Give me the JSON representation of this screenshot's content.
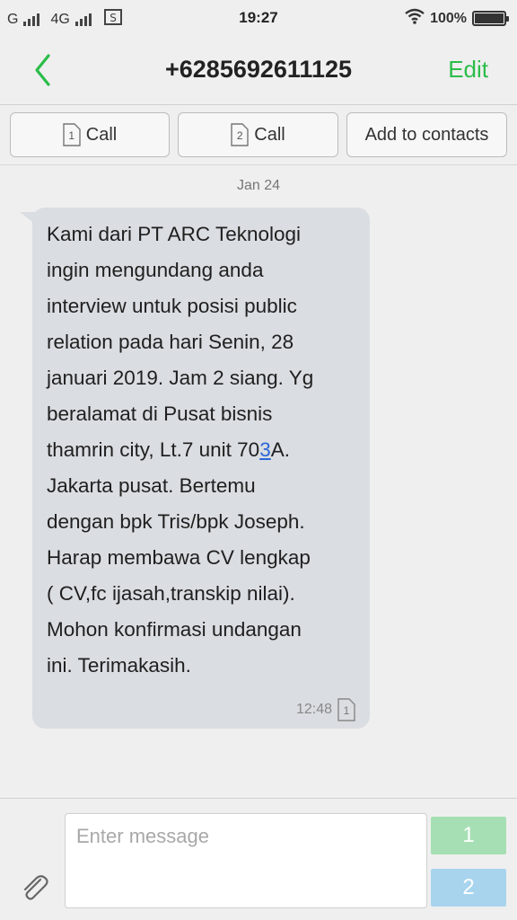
{
  "status_bar": {
    "carrier_1": "G",
    "carrier_2": "4G",
    "time": "19:27",
    "battery": "100%",
    "battery_level": 1.0,
    "icons": [
      "signal-icon",
      "sim-status-icon",
      "wifi-icon",
      "battery-icon"
    ]
  },
  "header": {
    "title": "+6285692611125",
    "edit_label": "Edit",
    "back_icon": "chevron-left-icon",
    "accent_color": "#2bbd4a"
  },
  "actions": {
    "call_sim1_label": "Call",
    "call_sim1_num": "1",
    "call_sim2_label": "Call",
    "call_sim2_num": "2",
    "add_contacts_label": "Add to contacts"
  },
  "conversation": {
    "date": "Jan 24",
    "message": {
      "text_before": "Kami dari PT ARC Teknologi\ningin mengundang anda\ninterview untuk posisi public\nrelation pada hari Senin, 28\njanuari 2019. Jam 2 siang. Yg\nberalamat di Pusat bisnis\nthamrin city, Lt.7 unit 70",
      "link": "3",
      "text_after": "A.\nJakarta pusat. Bertemu\ndengan bpk Tris/bpk Joseph.\nHarap membawa CV lengkap\n( CV,fc ijasah,transkip nilai).\nMohon konfirmasi undangan\nini. Terimakasih.",
      "time": "12:48",
      "sim": "1"
    }
  },
  "compose": {
    "placeholder": "Enter message",
    "send_sim1": "1",
    "send_sim2": "2",
    "attach_icon": "paperclip-icon"
  }
}
